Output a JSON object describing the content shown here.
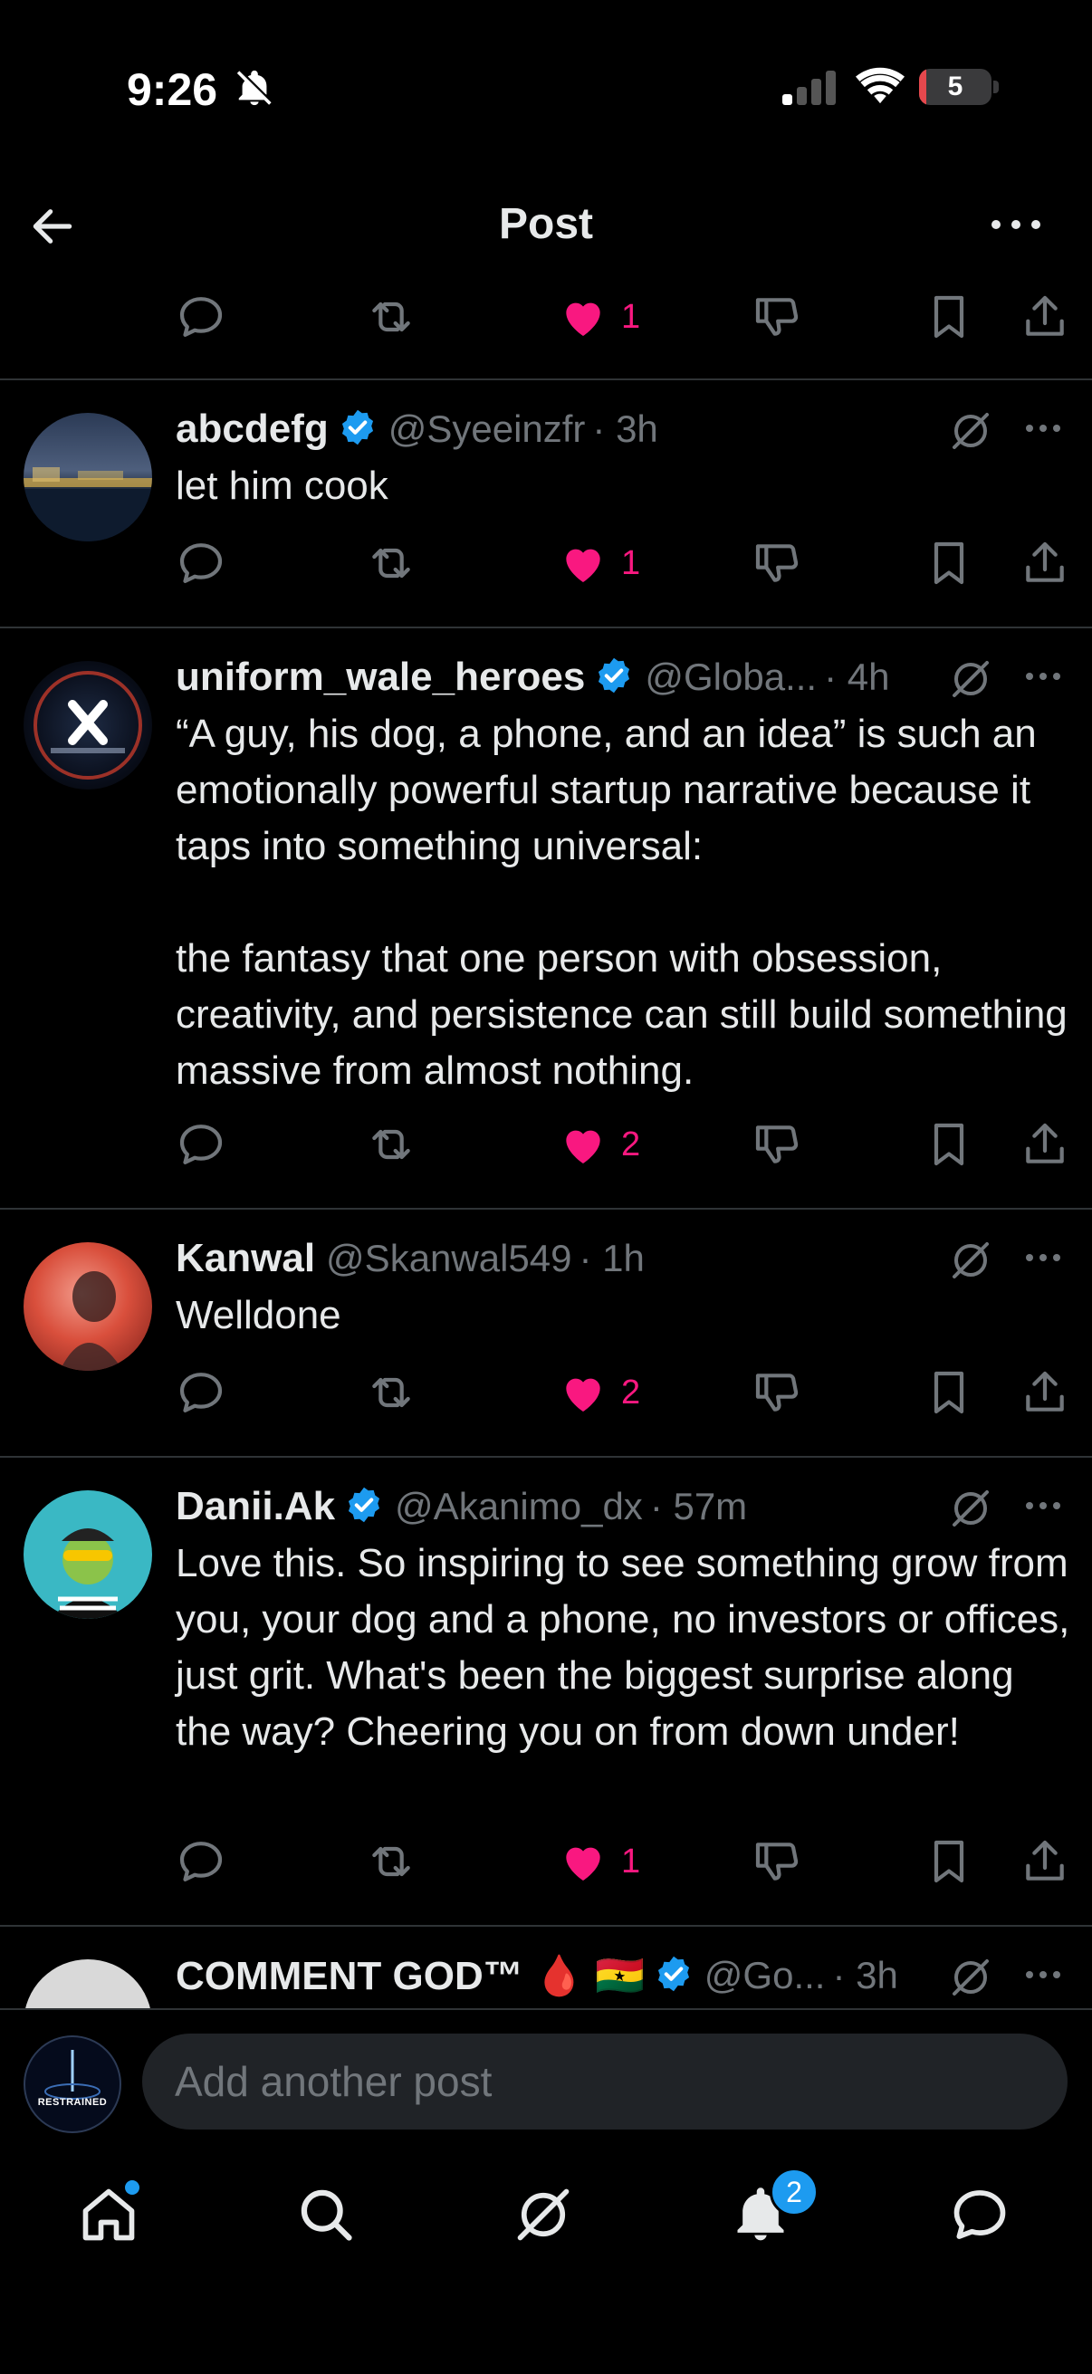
{
  "status_bar": {
    "time": "9:26",
    "battery": "5"
  },
  "header": {
    "title": "Post"
  },
  "top_actions": {
    "like_count": "1"
  },
  "replies": [
    {
      "name": "abcdefg",
      "verified": true,
      "handle": "@Syeeinzfr",
      "time": "· 3h",
      "text": "let him cook",
      "likes": "1"
    },
    {
      "name": "uniform_wale_heroes",
      "verified": true,
      "handle": "@Globa...",
      "time": "· 4h",
      "text": "“A guy, his dog, a phone, and an idea” is such an emotionally powerful startup narrative because it taps into something universal:\n\nthe fantasy that one person with obsession, creativity, and persistence can still build something massive from almost nothing.",
      "likes": "2"
    },
    {
      "name": "Kanwal",
      "verified": false,
      "handle": "@Skanwal549",
      "time": "· 1h",
      "text": "Welldone",
      "likes": "2"
    },
    {
      "name": "Danii.Ak",
      "verified": true,
      "handle": "@Akanimo_dx",
      "time": "· 57m",
      "text": "Love this. So inspiring to see something grow from you, your dog and a phone, no investors or offices, just grit. What's been the biggest surprise along the way? Cheering you on from down under!",
      "likes": "1"
    },
    {
      "name": "COMMENT GOD™ 🩸 🇬🇭",
      "verified": true,
      "handle": "@Go...",
      "time": "· 3h"
    }
  ],
  "composer": {
    "placeholder": "Add another post",
    "avatar_label": "RESTRAINED"
  },
  "tab_bar": {
    "notifications_badge": "2"
  },
  "colors": {
    "like": "#f91880",
    "verified": "#1d9bf0",
    "muted": "#71767b",
    "divider": "#2f3336"
  }
}
